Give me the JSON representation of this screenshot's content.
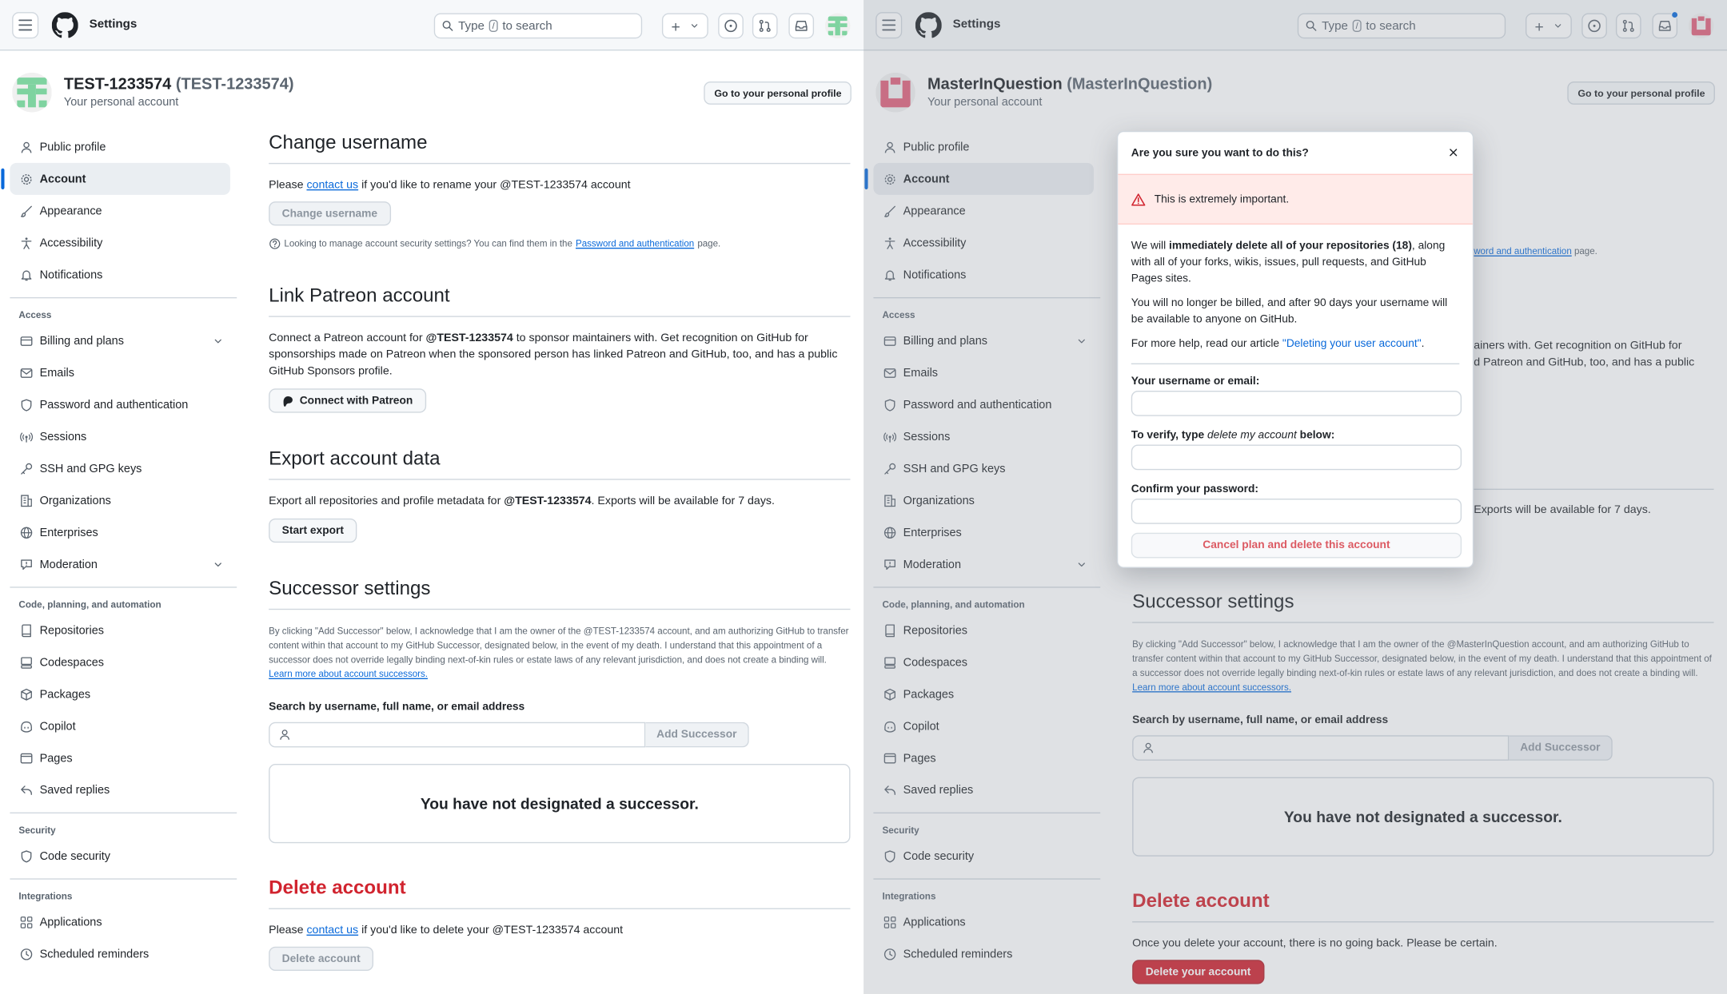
{
  "header": {
    "title": "Settings",
    "search_type": "Type",
    "search_key": "/",
    "search_rest": "to search"
  },
  "left": {
    "username": "TEST-1233574",
    "username_paren": "(TEST-1233574)",
    "subtitle": "Your personal account",
    "profile_button": "Go to your personal profile",
    "change_username": {
      "title": "Change username",
      "please": "Please",
      "contact": "contact us",
      "rest": "if you'd like to rename your @TEST-1233574 account",
      "button": "Change username",
      "note": "Looking to manage account security settings? You can find them in the",
      "note_link": "Password and authentication",
      "note_end": "page."
    },
    "patreon": {
      "title": "Link Patreon account",
      "text_a": "Connect a Patreon account for",
      "text_user": "@TEST-1233574",
      "text_b": "to sponsor maintainers with. Get recognition on GitHub for sponsorships made on Patreon when the sponsored person has linked Patreon and GitHub, too, and has a public GitHub Sponsors profile.",
      "button": "Connect with Patreon"
    },
    "export": {
      "title": "Export account data",
      "text_a": "Export all repositories and profile metadata for",
      "text_user": "@TEST-1233574",
      "text_b": ". Exports will be available for 7 days.",
      "button": "Start export"
    },
    "successor": {
      "title": "Successor settings",
      "text": "By clicking \"Add Successor\" below, I acknowledge that I am the owner of the @TEST-1233574 account, and am authorizing GitHub to transfer content within that account to my GitHub Successor, designated below, in the event of my death. I understand that this appointment of a successor does not override legally binding next-of-kin rules or estate laws of any relevant jurisdiction, and does not create a binding will.",
      "link": "Learn more about account successors.",
      "search_label": "Search by username, full name, or email address",
      "add_button": "Add Successor",
      "empty": "You have not designated a successor."
    },
    "delete": {
      "title": "Delete account",
      "please": "Please",
      "contact": "contact us",
      "rest": "if you'd like to delete your @TEST-1233574 account",
      "button": "Delete account"
    }
  },
  "right": {
    "username": "MasterInQuestion",
    "username_paren": "(MasterInQuestion)",
    "subtitle": "Your personal account",
    "profile_button": "Go to your personal profile",
    "bg_link": "word and authentication",
    "bg_link_end": "page.",
    "bg_patreon_1": "ainers with. Get recognition on GitHub for",
    "bg_patreon_2": "d Patreon and GitHub, too, and has a public",
    "bg_export": "Exports will be available for 7 days.",
    "successor": {
      "title": "Successor settings",
      "text": "By clicking \"Add Successor\" below, I acknowledge that I am the owner of the @MasterInQuestion account, and am authorizing GitHub to transfer content within that account to my GitHub Successor, designated below, in the event of my death. I understand that this appointment of a successor does not override legally binding next-of-kin rules or estate laws of any relevant jurisdiction, and does not create a binding will.",
      "link": "Learn more about account successors.",
      "search_label": "Search by username, full name, or email address",
      "add_button": "Add Successor",
      "empty": "You have not designated a successor."
    },
    "delete": {
      "title": "Delete account",
      "text": "Once you delete your account, there is no going back. Please be certain.",
      "button": "Delete your account"
    },
    "modal": {
      "title": "Are you sure you want to do this?",
      "warning": "This is extremely important.",
      "p1_a": "We will",
      "p1_b": "immediately delete all of your repositories (18)",
      "p1_c": ", along with all of your forks, wikis, issues, pull requests, and GitHub Pages sites.",
      "p2": "You will no longer be billed, and after 90 days your username will be available to anyone on GitHub.",
      "p3_a": "For more help, read our article",
      "p3_link": "\"Deleting your user account\"",
      "p3_end": ".",
      "label_user": "Your username or email:",
      "label_verify_a": "To verify, type",
      "label_verify_em": "delete my account",
      "label_verify_b": "below:",
      "label_pass": "Confirm your password:",
      "confirm_button": "Cancel plan and delete this account"
    }
  },
  "sidebar": {
    "items_top": [
      "Public profile",
      "Account",
      "Appearance",
      "Accessibility",
      "Notifications"
    ],
    "group_access": "Access",
    "items_access": [
      "Billing and plans",
      "Emails",
      "Password and authentication",
      "Sessions",
      "SSH and GPG keys",
      "Organizations",
      "Enterprises",
      "Moderation"
    ],
    "group_code": "Code, planning, and automation",
    "items_code": [
      "Repositories",
      "Codespaces",
      "Packages",
      "Copilot",
      "Pages",
      "Saved replies"
    ],
    "group_security": "Security",
    "items_security": [
      "Code security"
    ],
    "group_integrations": "Integrations",
    "items_integrations": [
      "Applications",
      "Scheduled reminders"
    ]
  },
  "colors": {
    "accent": "#0969da",
    "danger": "#d1242f",
    "border": "#d0d7de",
    "avatar_left": "#7fd3a0",
    "avatar_right": "#e0607a"
  }
}
